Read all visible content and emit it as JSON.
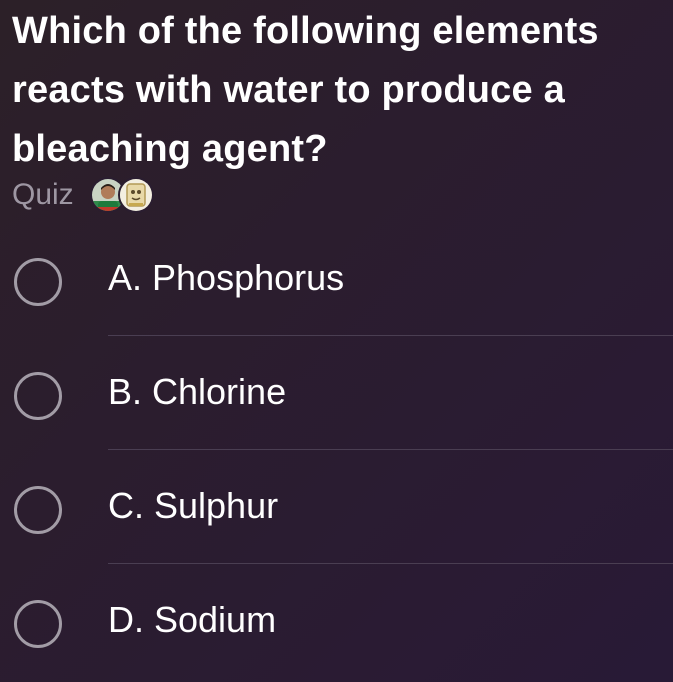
{
  "question": {
    "line1": "Which of the following elements",
    "line2": "reacts with water to produce a",
    "line3": "bleaching agent?"
  },
  "quiz": {
    "label": "Quiz",
    "avatars": [
      "person-avatar",
      "mascot-avatar"
    ]
  },
  "options": [
    {
      "label": "A. Phosphorus",
      "selected": false
    },
    {
      "label": "B. Chlorine",
      "selected": false
    },
    {
      "label": "C. Sulphur",
      "selected": false
    },
    {
      "label": "D. Sodium",
      "selected": false
    }
  ],
  "colors": {
    "background": "#2a1c31",
    "text": "#ffffff",
    "muted": "#9e97a3",
    "radio_border": "#a29ca6",
    "divider": "#4a3e52"
  }
}
